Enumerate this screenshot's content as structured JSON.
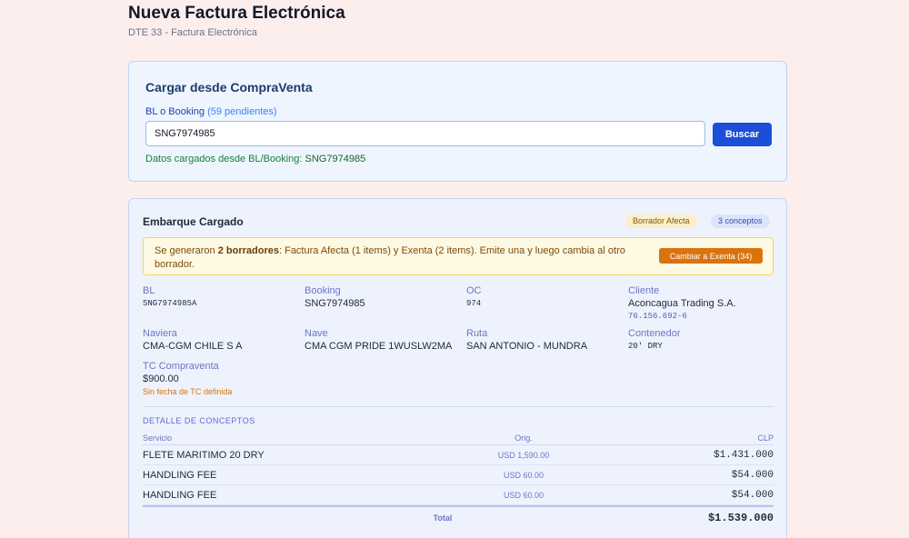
{
  "header": {
    "title": "Nueva Factura Electrónica",
    "subtitle": "DTE 33 - Factura Electrónica"
  },
  "load_card": {
    "title": "Cargar desde CompraVenta",
    "field_label": "BL o Booking",
    "pending": "(59 pendientes)",
    "input_value": "SNG7974985",
    "search_label": "Buscar",
    "loaded_prefix": "Datos cargados desde BL/Booking:",
    "loaded_value": "SNG7974985"
  },
  "shipment": {
    "title": "Embarque Cargado",
    "badge_draft": "Borrador Afecta",
    "badge_concepts": "3 conceptos",
    "alert": {
      "prefix": "Se generaron",
      "bold": "2 borradores",
      "rest": ": Factura Afecta (1 items) y Exenta (2 items). Emite una y luego cambia al otro borrador.",
      "button": "Cambiar a Exenta (34)"
    },
    "fields": {
      "bl_label": "BL",
      "bl_value": "SNG7974985A",
      "booking_label": "Booking",
      "booking_value": "SNG7974985",
      "oc_label": "OC",
      "oc_value": "974",
      "cliente_label": "Cliente",
      "cliente_value": "Aconcagua Trading S.A.",
      "cliente_rut": "76.156.692-6",
      "naviera_label": "Naviera",
      "naviera_value": "CMA-CGM CHILE S A",
      "nave_label": "Nave",
      "nave_value": "CMA CGM PRIDE 1WUSLW2MA",
      "ruta_label": "Ruta",
      "ruta_value": "SAN ANTONIO - MUNDRA",
      "contenedor_label": "Contenedor",
      "contenedor_value": "20' DRY",
      "tc_label": "TC Compraventa",
      "tc_value": "$900.00",
      "tc_warning": "Sin fecha de TC definida"
    },
    "detail": {
      "title": "DETALLE DE CONCEPTOS",
      "headers": {
        "servicio": "Servicio",
        "orig": "Orig.",
        "clp": "CLP"
      },
      "rows": [
        {
          "servicio": "FLETE MARITIMO 20 DRY",
          "orig": "USD 1,590.00",
          "clp": "$1.431.000"
        },
        {
          "servicio": "HANDLING FEE",
          "orig": "USD 60.00",
          "clp": "$54.000"
        },
        {
          "servicio": "HANDLING FEE",
          "orig": "USD 60.00",
          "clp": "$54.000"
        }
      ],
      "total_label": "Total",
      "total_value": "$1.539.000"
    }
  }
}
